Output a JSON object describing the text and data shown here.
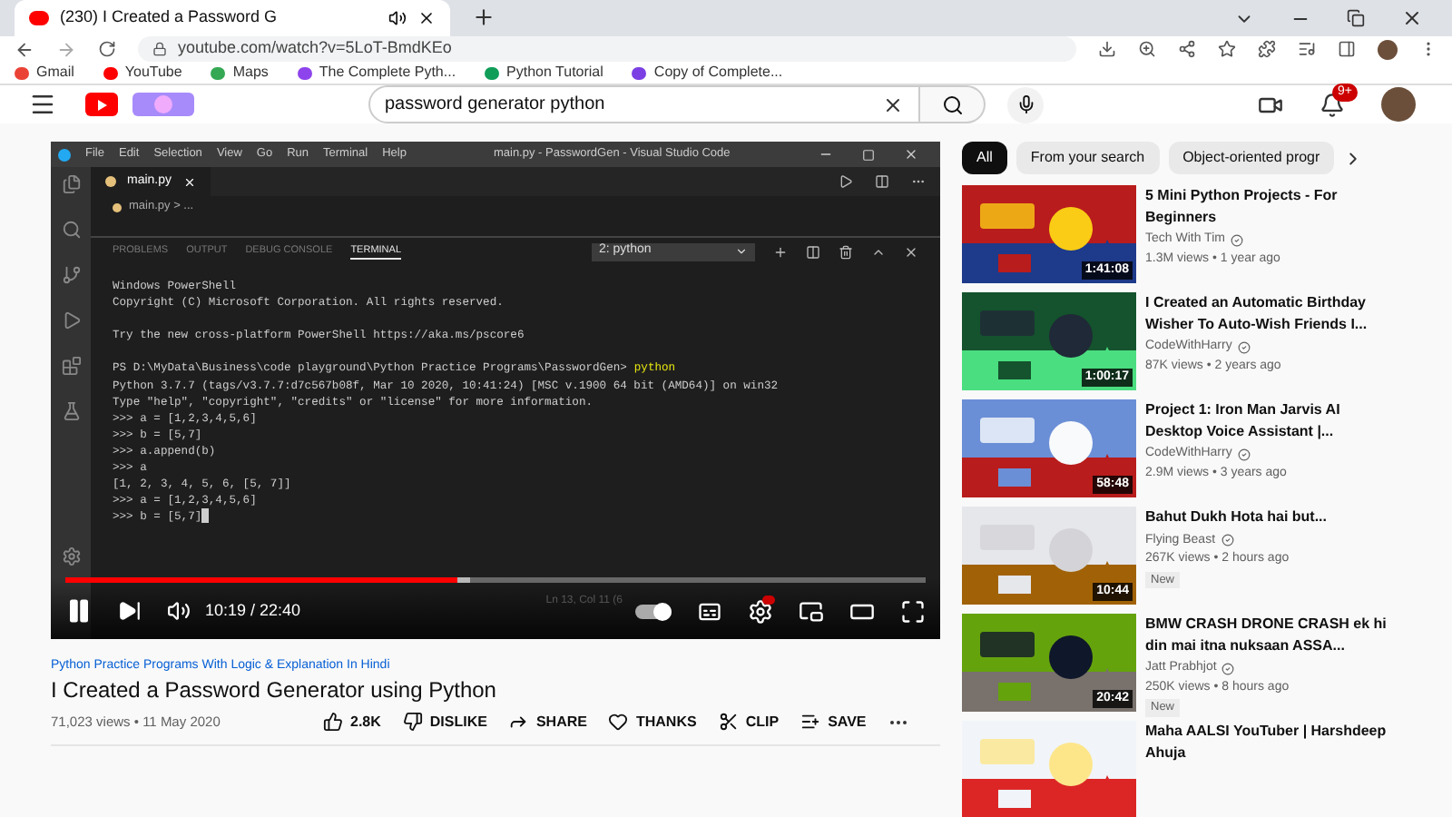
{
  "browser": {
    "tab": {
      "title": "(230) I Created a Password G"
    },
    "url": "youtube.com/watch?v=5LoT-BmdKEo",
    "bookmarks": [
      {
        "label": "Gmail",
        "color": "#ea4335"
      },
      {
        "label": "YouTube",
        "color": "#ff0000"
      },
      {
        "label": "Maps",
        "color": "#34a853"
      },
      {
        "label": "The Complete Pyth...",
        "color": "#8e44ec"
      },
      {
        "label": "Python Tutorial",
        "color": "#0f9d58"
      },
      {
        "label": "Copy of Complete...",
        "color": "#7b3fe4"
      }
    ]
  },
  "header": {
    "search": {
      "value": "password generator python"
    },
    "notifications": "9+"
  },
  "video": {
    "vscode": {
      "menu": [
        "File",
        "Edit",
        "Selection",
        "View",
        "Go",
        "Run",
        "Terminal",
        "Help"
      ],
      "title": "main.py - PasswordGen - Visual Studio Code",
      "tab": "main.py",
      "breadcrumb": "main.py > ...",
      "panel_tabs": [
        {
          "label": "PROBLEMS",
          "selected": false
        },
        {
          "label": "OUTPUT",
          "selected": false
        },
        {
          "label": "DEBUG CONSOLE",
          "selected": false
        },
        {
          "label": "TERMINAL",
          "selected": true
        }
      ],
      "terminal_select": "2: python",
      "terminal": [
        {
          "kind": "output",
          "text": "Windows PowerShell"
        },
        {
          "kind": "output",
          "text": "Copyright (C) Microsoft Corporation. All rights reserved."
        },
        {
          "kind": "blank"
        },
        {
          "kind": "output",
          "text": "Try the new cross-platform PowerShell https://aka.ms/pscore6"
        },
        {
          "kind": "blank"
        },
        {
          "kind": "command",
          "text": "PS D:\\MyData\\Business\\code playground\\Python Practice Programs\\PasswordGen>",
          "command": "python"
        },
        {
          "kind": "output",
          "text": "Python 3.7.7 (tags/v3.7.7:d7c567b08f, Mar 10 2020, 10:41:24) [MSC v.1900 64 bit (AMD64)] on win32"
        },
        {
          "kind": "output",
          "text": "Type \"help\", \"copyright\", \"credits\" or \"license\" for more information."
        },
        {
          "kind": "output",
          "text": ">>> a = [1,2,3,4,5,6]"
        },
        {
          "kind": "output",
          "text": ">>> b = [5,7]"
        },
        {
          "kind": "output",
          "text": ">>> a.append(b)"
        },
        {
          "kind": "output",
          "text": ">>> a"
        },
        {
          "kind": "output",
          "text": "[1, 2, 3, 4, 5, 6, [5, 7]]"
        },
        {
          "kind": "output",
          "text": ">>> a = [1,2,3,4,5,6]"
        },
        {
          "kind": "output",
          "text": ">>> b = [5,7]",
          "cursor": true
        }
      ],
      "status": "Ln 13, Col 11 (6"
    },
    "player": {
      "level": 0.455,
      "playing": true,
      "time": "10:19 / 22:40",
      "autoplay": true
    }
  },
  "below": {
    "channel_link": "Python Practice Programs With Logic & Explanation In Hindi",
    "title": "I Created a Password Generator using Python",
    "meta": "71,023 views • 11 May 2020",
    "actions": [
      {
        "kind": "like",
        "label": "2.8K"
      },
      {
        "kind": "dislike",
        "label": "DISLIKE"
      },
      {
        "kind": "share",
        "label": "SHARE"
      },
      {
        "kind": "thanks",
        "label": "THANKS"
      },
      {
        "kind": "clip",
        "label": "CLIP"
      },
      {
        "kind": "save",
        "label": "SAVE"
      }
    ]
  },
  "chips": [
    {
      "label": "All",
      "selected": true
    },
    {
      "label": "From your search",
      "selected": false
    },
    {
      "label": "Object-oriented progr",
      "selected": false
    }
  ],
  "related": [
    {
      "title": "5 Mini Python Projects - For Beginners",
      "channel": "Tech With Tim",
      "verified": true,
      "meta": "1.3M views • 1 year ago",
      "duration": "1:41:08"
    },
    {
      "title": "I Created an Automatic Birthday Wisher To Auto-Wish Friends I...",
      "channel": "CodeWithHarry",
      "verified": true,
      "meta": "87K views • 2 years ago",
      "duration": "1:00:17"
    },
    {
      "title": "Project 1: Iron Man Jarvis AI Desktop Voice Assistant |...",
      "channel": "CodeWithHarry",
      "verified": true,
      "meta": "2.9M views • 3 years ago",
      "duration": "58:48"
    },
    {
      "title": "Bahut Dukh Hota hai but...",
      "channel": "Flying Beast",
      "verified": true,
      "meta": "267K views • 2 hours ago",
      "duration": "10:44",
      "badge": "New"
    },
    {
      "title": "BMW CRASH DRONE CRASH ek hi din mai itna nuksaan ASSA...",
      "channel": "Jatt Prabhjot",
      "verified": true,
      "meta": "250K views • 8 hours ago",
      "duration": "20:42",
      "badge": "New"
    },
    {
      "title": "Maha AALSI YouTuber | Harshdeep Ahuja"
    }
  ]
}
